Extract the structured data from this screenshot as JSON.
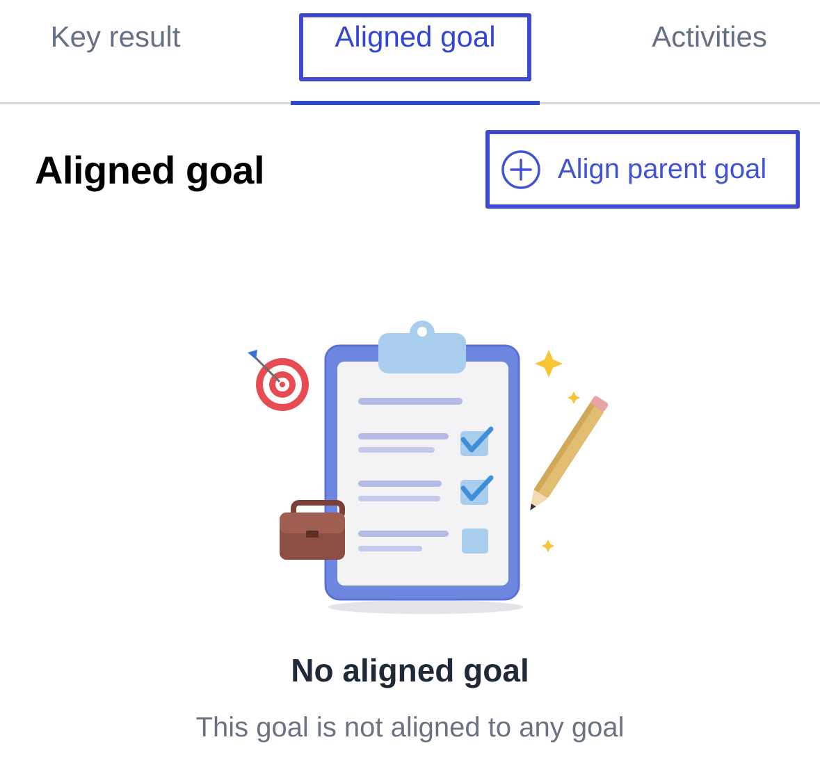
{
  "tabs": [
    {
      "label": "Key result",
      "active": false
    },
    {
      "label": "Aligned goal",
      "active": true
    },
    {
      "label": "Activities",
      "active": false
    }
  ],
  "section": {
    "title": "Aligned goal",
    "align_button_label": "Align parent goal",
    "align_button_icon": "plus-circle-icon"
  },
  "empty_state": {
    "illustration": "clipboard-checklist-illustration",
    "title": "No aligned goal",
    "subtitle": "This goal is not aligned to any goal"
  },
  "colors": {
    "accent": "#3346d3",
    "highlight_box": "#3f49cf",
    "muted_text": "#667085"
  }
}
